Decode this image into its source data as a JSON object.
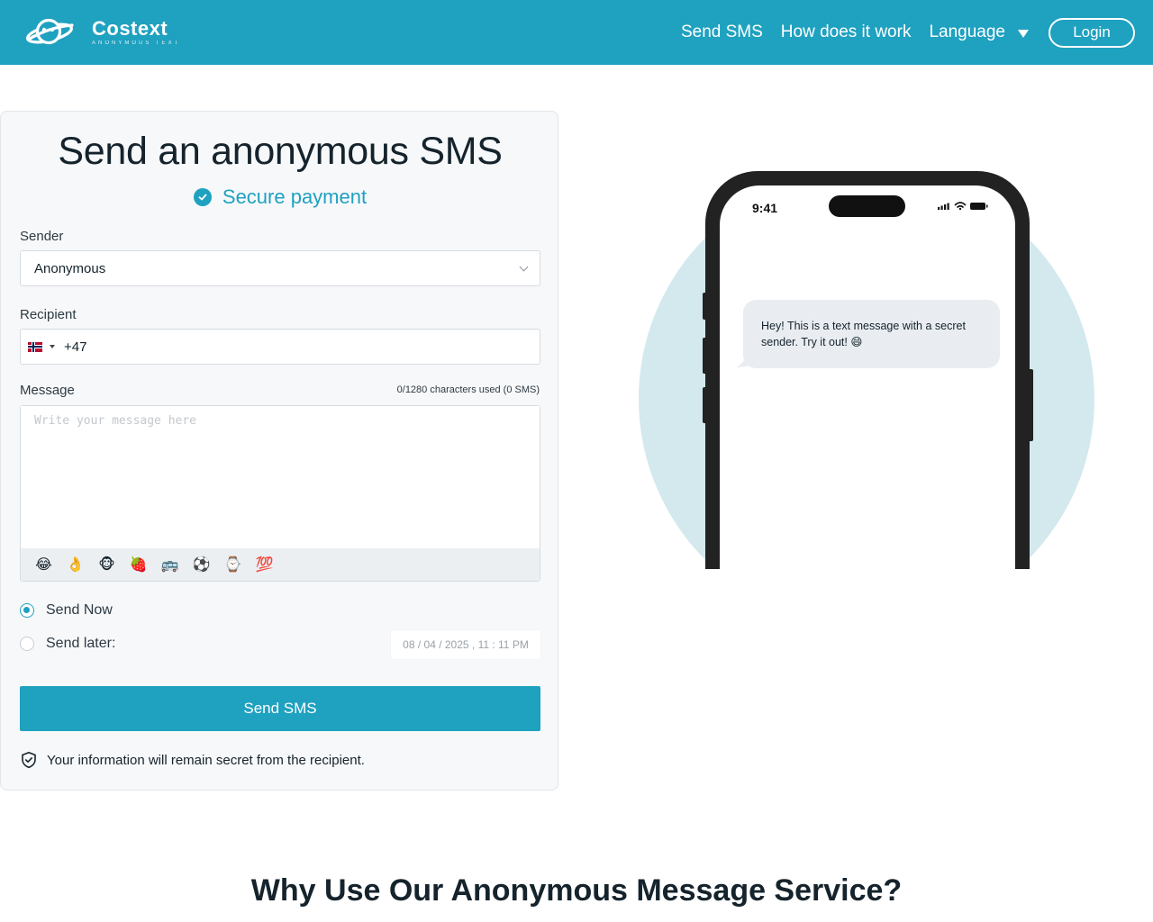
{
  "brand": {
    "name": "Costext",
    "tagline": "ANONYMOUS TEXT"
  },
  "nav": {
    "send_sms": "Send SMS",
    "how_it_works": "How does it work",
    "language": "Language",
    "login": "Login"
  },
  "colors": {
    "primary": "#1fa1c0",
    "illustration_circle": "#d3e9ee",
    "bubble": "#e9edf2"
  },
  "form": {
    "title": "Send an anonymous SMS",
    "secure_payment": "Secure payment",
    "sender_label": "Sender",
    "sender_value": "Anonymous",
    "recipient_label": "Recipient",
    "recipient_country": "Norway",
    "recipient_dial_code": "+47",
    "message_label": "Message",
    "char_counter": "0/1280 characters used (0 SMS)",
    "message_placeholder": "Write your message here",
    "emojis": [
      "😂",
      "👌",
      "🐵",
      "🍓",
      "🚌",
      "⚽",
      "⌚",
      "💯"
    ],
    "send_now_label": "Send Now",
    "send_later_label": "Send later:",
    "send_now_selected": true,
    "datetime_value": "08 / 04 / 2025 ,  11 : 11   PM",
    "submit_label": "Send SMS",
    "privacy_note": "Your information will remain secret from the recipient."
  },
  "phone_preview": {
    "time": "9:41",
    "message": "Hey! This is a text message with a secret sender. Try it out! 😄"
  },
  "section": {
    "why_heading": "Why Use Our Anonymous Message Service?"
  }
}
